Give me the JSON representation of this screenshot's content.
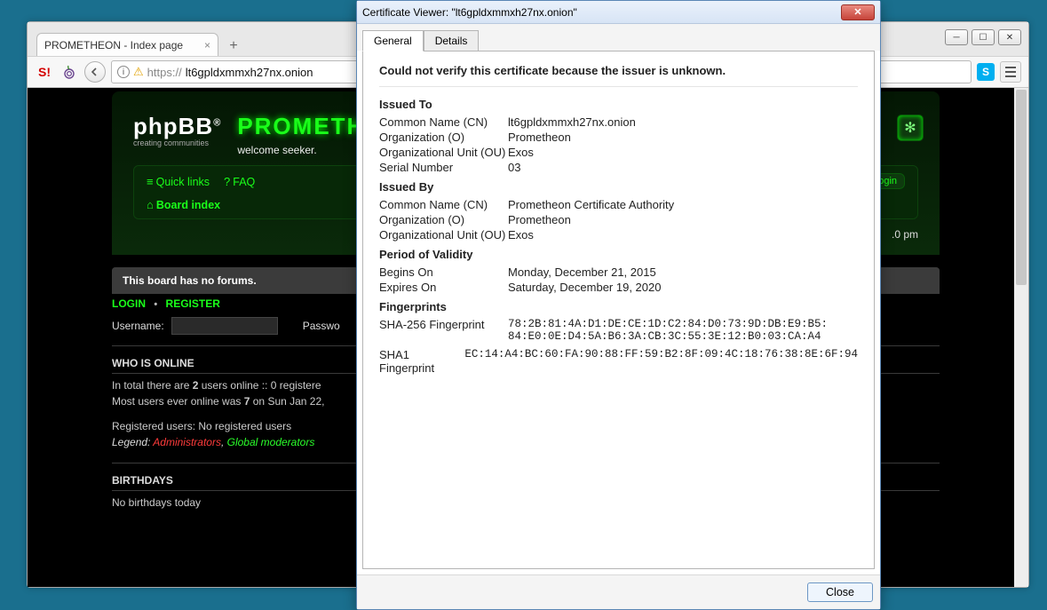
{
  "browser": {
    "tab_title": "PROMETHEON - Index page",
    "url_scheme": "https://",
    "url_host": "lt6gpldxmmxh27nx.onion",
    "skype_glyph": "S"
  },
  "forum": {
    "logo_text": "phpBB",
    "logo_tag": "creating communities",
    "site_title": "PROMETHEON",
    "site_sub": "welcome seeker.",
    "quick_links": "Quick links",
    "faq": "FAQ",
    "board_index": "Board index",
    "login_pill": "ogin",
    "time_suffix": ".0 pm",
    "no_forums": "This board has no forums.",
    "login_label": "LOGIN",
    "register_label": "REGISTER",
    "username_label": "Username:",
    "password_label": "Passwo",
    "who_online": "WHO IS ONLINE",
    "online_line1_a": "In total there are ",
    "online_line1_b": "2",
    "online_line1_c": " users online :: 0 registere",
    "online_line2_a": "Most users ever online was ",
    "online_line2_b": "7",
    "online_line2_c": " on Sun Jan 22, ",
    "reg_users": "Registered users: No registered users",
    "legend_label": "Legend: ",
    "admins": "Administrators",
    "mods": "Global moderators",
    "birthdays": "BIRTHDAYS",
    "no_birthdays": "No birthdays today"
  },
  "cert": {
    "title": "Certificate Viewer: \"lt6gpldxmmxh27nx.onion\"",
    "tab_general": "General",
    "tab_details": "Details",
    "error": "Could not verify this certificate because the issuer is unknown.",
    "issued_to": "Issued To",
    "issued_by": "Issued By",
    "validity": "Period of Validity",
    "fingerprints": "Fingerprints",
    "labels": {
      "cn": "Common Name (CN)",
      "o": "Organization (O)",
      "ou": "Organizational Unit (OU)",
      "sn": "Serial Number",
      "begins": "Begins On",
      "expires": "Expires On",
      "sha256": "SHA-256 Fingerprint",
      "sha1": "SHA1 Fingerprint"
    },
    "to": {
      "cn": "lt6gpldxmmxh27nx.onion",
      "o": "Prometheon",
      "ou": "Exos",
      "sn": "03"
    },
    "by": {
      "cn": "Prometheon Certificate Authority",
      "o": "Prometheon",
      "ou": "Exos"
    },
    "valid": {
      "begins": "Monday, December 21, 2015",
      "expires": "Saturday, December 19, 2020"
    },
    "fp": {
      "sha256": "78:2B:81:4A:D1:DE:CE:1D:C2:84:D0:73:9D:DB:E9:B5:\n84:E0:0E:D4:5A:B6:3A:CB:3C:55:3E:12:B0:03:CA:A4",
      "sha1": "EC:14:A4:BC:60:FA:90:88:FF:59:B2:8F:09:4C:18:76:38:8E:6F:94"
    },
    "close": "Close"
  }
}
